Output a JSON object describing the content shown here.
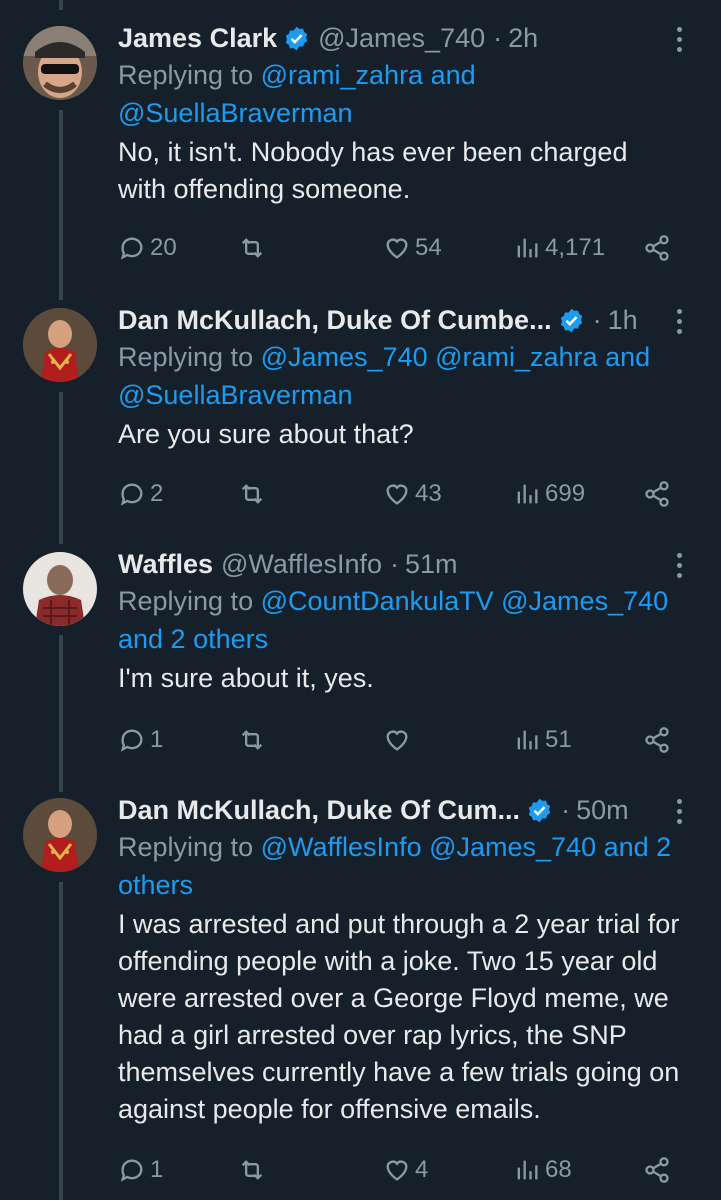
{
  "tweets": [
    {
      "name": "James Clark",
      "verified": true,
      "handle": "@James_740",
      "dot": "·",
      "time": "2h",
      "replying_prefix": "Replying to",
      "mentions_line1": "@rami_zahra and",
      "mentions_line2": "@SuellaBraverman",
      "text": "No, it isn't.  Nobody has ever been charged with offending someone.",
      "replies": "20",
      "retweets": "",
      "likes": "54",
      "views": "4,171"
    },
    {
      "name": "Dan McKullach, Duke Of Cumbe...",
      "verified": true,
      "handle": "",
      "dot": "·",
      "time": "1h",
      "replying_prefix": "Replying to",
      "mentions_line1": "@James_740 @rami_zahra and",
      "mentions_line2": "@SuellaBraverman",
      "text": "Are you sure about that?",
      "replies": "2",
      "retweets": "",
      "likes": "43",
      "views": "699"
    },
    {
      "name": "Waffles",
      "verified": false,
      "handle": "@WafflesInfo",
      "dot": "·",
      "time": "51m",
      "replying_prefix": "Replying to",
      "mentions_line1": "@CountDankulaTV @James_740",
      "mentions_line2": "and 2 others",
      "text": "I'm sure about it, yes.",
      "replies": "1",
      "retweets": "",
      "likes": "",
      "views": "51"
    },
    {
      "name": "Dan McKullach, Duke Of Cum...",
      "verified": true,
      "handle": "",
      "dot": "·",
      "time": "50m",
      "replying_prefix": "Replying to",
      "mentions_line1": "@WafflesInfo @James_740 and 2",
      "mentions_line2": "others",
      "text": "I was arrested and put through a 2 year trial for offending people with a joke. Two 15 year old were arrested over a George Floyd meme, we had a girl arrested over rap lyrics, the SNP themselves currently have a few trials going on against people for offensive emails.",
      "replies": "1",
      "retweets": "",
      "likes": "4",
      "views": "68"
    }
  ],
  "colors": {
    "background": "#15202b",
    "text": "#e7e9ea",
    "muted": "#8b98a5",
    "link": "#1d9bf0",
    "verified": "#1d9bf0"
  },
  "icons": [
    "reply-icon",
    "retweet-icon",
    "like-icon",
    "views-icon",
    "share-icon",
    "more-icon",
    "verified-badge-icon"
  ]
}
